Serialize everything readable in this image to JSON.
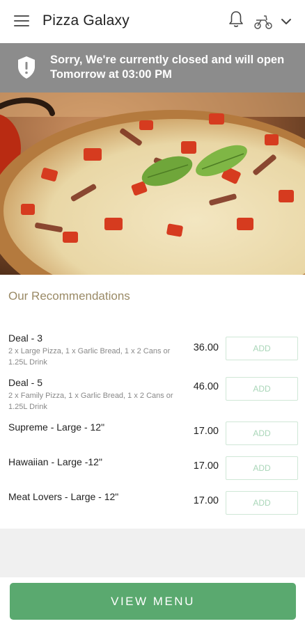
{
  "header": {
    "title": "Pizza Galaxy",
    "menu_icon": "hamburger-icon",
    "notification_icon": "bell-icon",
    "delivery_icon": "scooter-icon",
    "dropdown_icon": "chevron-down-icon"
  },
  "banner": {
    "icon": "shield-alert-icon",
    "message": "Sorry, We're currently closed and will open Tomorrow at 03:00 PM"
  },
  "recommendations": {
    "title": "Our Recommendations",
    "items": [
      {
        "name": "Deal - 3",
        "description": "2 x Large Pizza, 1 x Garlic Bread, 1 x 2 Cans or 1.25L Drink",
        "price": "36.00",
        "button": "ADD"
      },
      {
        "name": "Deal - 5",
        "description": "2 x Family Pizza, 1 x Garlic Bread, 1 x 2 Cans or 1.25L Drink",
        "price": "46.00",
        "button": "ADD"
      },
      {
        "name": "Supreme - Large - 12\"",
        "description": "",
        "price": "17.00",
        "button": "ADD"
      },
      {
        "name": "Hawaiian - Large -12\"",
        "description": "",
        "price": "17.00",
        "button": "ADD"
      },
      {
        "name": "Meat Lovers - Large - 12\"",
        "description": "",
        "price": "17.00",
        "button": "ADD"
      }
    ]
  },
  "footer": {
    "view_menu_label": "VIEW MENU"
  },
  "colors": {
    "banner_bg": "#8c8c8c",
    "accent_green": "#5aa96f",
    "section_title": "#9a8a66"
  }
}
